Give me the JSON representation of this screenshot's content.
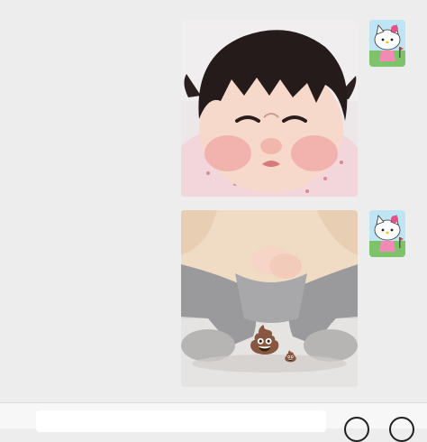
{
  "chat": {
    "messages": [
      {
        "type": "image",
        "subject": "baby-funny-face",
        "sender": "self"
      },
      {
        "type": "image",
        "subject": "baby-squatting-poop",
        "sender": "self",
        "overlay_icons": [
          "poop-emoji-large",
          "poop-emoji-small"
        ]
      }
    ],
    "avatar_icon": "hello-kitty-avatar-icon"
  },
  "input_bar": {
    "input_value": "",
    "buttons": [
      "emoji-button",
      "add-button"
    ]
  },
  "colors": {
    "chat_background": "#ededed",
    "input_bar_background": "#f7f7f7"
  }
}
